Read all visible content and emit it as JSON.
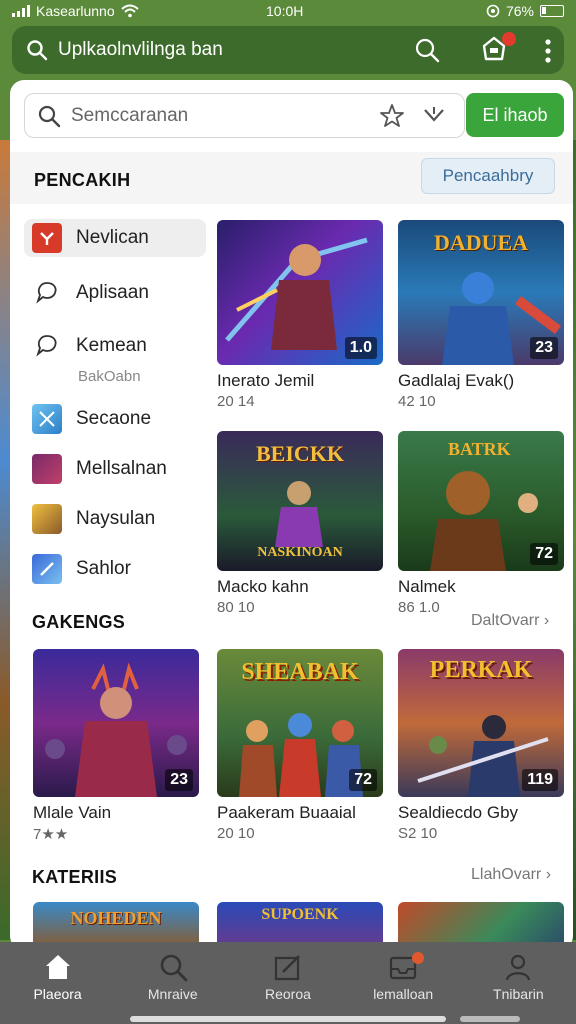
{
  "status": {
    "carrier": "Kasearlunno",
    "time": "10:0H",
    "battery": "76%"
  },
  "topbar": {
    "title": "Uplkaolnvlilnga ban",
    "badge": ""
  },
  "search": {
    "placeholder": "Semccaranan",
    "button": "El ihaob"
  },
  "section1": {
    "title": "PENCAKIH",
    "pill": "Pencaahbry"
  },
  "categories": [
    {
      "label": "Nevlican",
      "icon": "app-red-icon"
    },
    {
      "label": "Aplisaan",
      "icon": "chat-bubble-icon"
    },
    {
      "label": "Kemean",
      "sub": "BakOabn",
      "icon": "chat-bubble-icon"
    },
    {
      "label": "Secaone",
      "icon": "sword-app-icon"
    },
    {
      "label": "Mellsalnan",
      "icon": "game-app-icon"
    },
    {
      "label": "Naysulan",
      "icon": "character-app-icon"
    },
    {
      "label": "Sahlor",
      "icon": "blade-app-icon"
    }
  ],
  "featured": [
    {
      "name": "Inerato Jemil",
      "meta": "20 14",
      "tag": "1.0"
    },
    {
      "name": "Gadlalaj Evak()",
      "meta": "42 10",
      "tag": "23",
      "logo": "DADUEA"
    },
    {
      "name": "Macko kahn",
      "meta": "80 10",
      "tag": "",
      "logo": "BEICKK",
      "logo2": "NASKINOAN"
    },
    {
      "name": "Nalmek",
      "meta": "86 1.0",
      "tag": "72",
      "logo": "BATRK"
    }
  ],
  "section2": {
    "title": "GAKENGS",
    "more": "DaltOvarr"
  },
  "games": [
    {
      "name": "Mlale Vain",
      "meta": "7★★",
      "tag": "23"
    },
    {
      "name": "Paakeram Buaaial",
      "meta": "20 10",
      "tag": "72",
      "logo": "SHEABAK"
    },
    {
      "name": "Sealdiecdo Gby",
      "meta": "S2 10",
      "tag": "119",
      "logo": "PERKAK"
    }
  ],
  "section3": {
    "title": "KATERIIS",
    "more": "LlahOvarr"
  },
  "row3_logos": [
    "NOHEDEN",
    "SUPOENK",
    ""
  ],
  "nav": [
    {
      "label": "Plaeora",
      "icon": "home-icon"
    },
    {
      "label": "Mnraive",
      "icon": "search-icon"
    },
    {
      "label": "Reoroa",
      "icon": "edit-icon"
    },
    {
      "label": "lemalloan",
      "icon": "inbox-icon"
    },
    {
      "label": "Tnibarin",
      "icon": "profile-icon"
    }
  ],
  "colors": {
    "topbar": "#3d6b2c",
    "accent": "#3aa53a",
    "nav": "#5f5f5f"
  }
}
